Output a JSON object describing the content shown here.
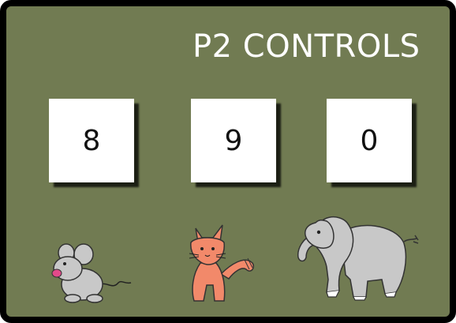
{
  "title": "P2 CONTROLS",
  "keys": [
    {
      "label": "8",
      "animal": "mouse-icon"
    },
    {
      "label": "9",
      "animal": "cat-icon"
    },
    {
      "label": "0",
      "animal": "elephant-icon"
    }
  ],
  "colors": {
    "background": "#717b52",
    "border": "#000000",
    "text": "#ffffff",
    "key": "#ffffff",
    "cat": "#f2896a",
    "animal_gray": "#c8c8c8"
  }
}
